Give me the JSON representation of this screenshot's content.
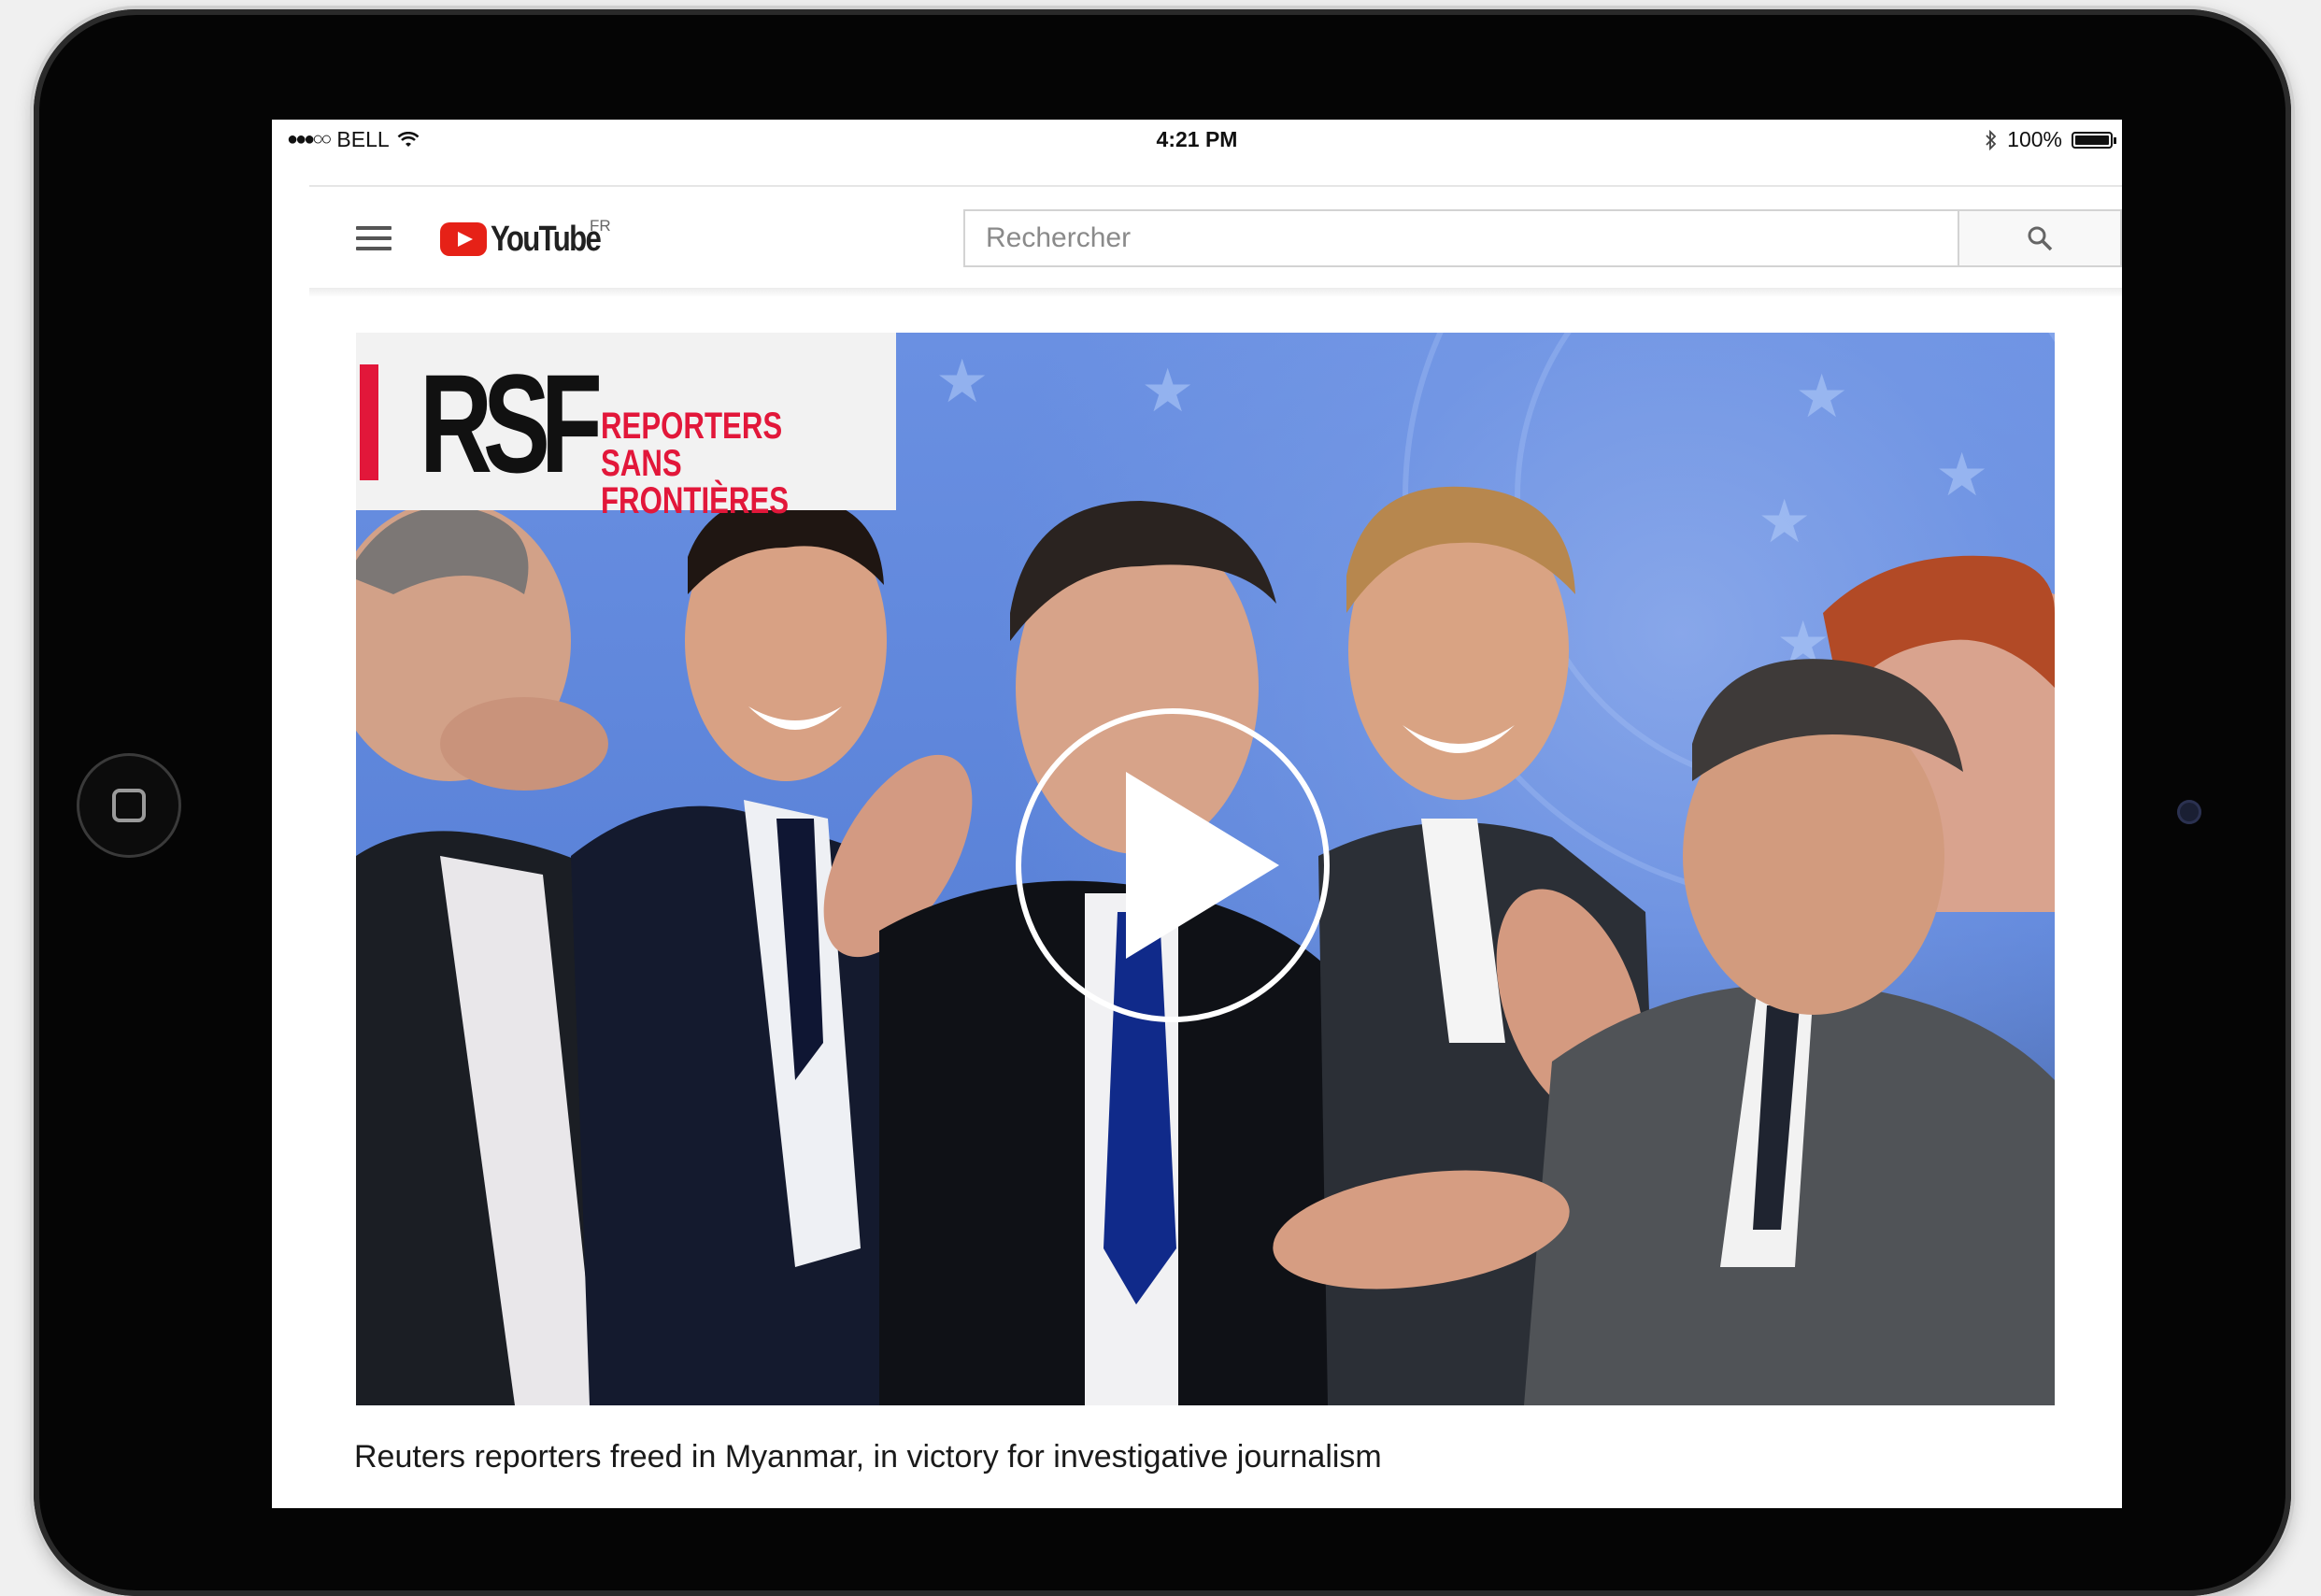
{
  "status_bar": {
    "carrier": "BELL",
    "time": "4:21 PM",
    "battery": "100%"
  },
  "header": {
    "logo_text": "YouTube",
    "region": "FR",
    "search_placeholder": "Rechercher"
  },
  "video": {
    "channel_logo_letters": "RSF",
    "channel_logo_line1": "REPORTERS",
    "channel_logo_line2": "SANS FRONTIÈRES",
    "title": "Reuters reporters freed in Myanmar, in victory for investigative journalism"
  },
  "icons": {
    "menu": "hamburger-menu-icon",
    "search": "search-icon",
    "play": "play-icon",
    "wifi": "wifi-icon",
    "bluetooth": "bluetooth-icon",
    "battery": "battery-icon"
  },
  "colors": {
    "youtube_red": "#e62117",
    "rsf_red": "#e2173a",
    "video_sky_blue": "#5f86db"
  }
}
